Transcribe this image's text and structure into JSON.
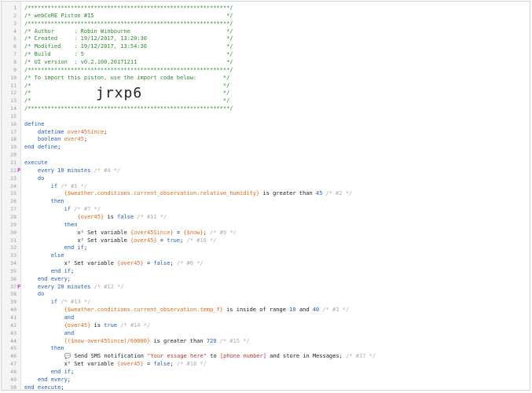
{
  "editor": {
    "lines": [
      {
        "n": "1",
        "segs": [
          {
            "c": "c",
            "t": "/*************************************************************/"
          }
        ]
      },
      {
        "n": "2",
        "segs": [
          {
            "c": "c",
            "t": "/* webCoRE Piston #15                                        */"
          }
        ]
      },
      {
        "n": "3",
        "segs": [
          {
            "c": "c",
            "t": "/*************************************************************/"
          }
        ]
      },
      {
        "n": "4",
        "segs": [
          {
            "c": "c",
            "t": "/* Author      : Robin Winbourne                             */"
          }
        ]
      },
      {
        "n": "5",
        "segs": [
          {
            "c": "c",
            "t": "/* Created     : 19/12/2017, 13:20:30                        */"
          }
        ]
      },
      {
        "n": "6",
        "segs": [
          {
            "c": "c",
            "t": "/* Modified    : 19/12/2017, 13:54:30                        */"
          }
        ]
      },
      {
        "n": "7",
        "segs": [
          {
            "c": "c",
            "t": "/* Build       : 5                                           */"
          }
        ]
      },
      {
        "n": "8",
        "segs": [
          {
            "c": "c",
            "t": "/* UI version  : v0.2.100.20171211                           */"
          }
        ]
      },
      {
        "n": "9",
        "segs": [
          {
            "c": "c",
            "t": "/*************************************************************/"
          }
        ]
      },
      {
        "n": "10",
        "segs": [
          {
            "c": "c",
            "t": "/* To import this piston, use the import code below:        */"
          }
        ]
      },
      {
        "n": "11",
        "segs": [
          {
            "c": "c",
            "t": "/*                                                          */"
          }
        ]
      },
      {
        "n": "12",
        "segs": [
          {
            "c": "c",
            "t": "/*                                                          */"
          }
        ]
      },
      {
        "n": "13",
        "segs": [
          {
            "c": "c",
            "t": "/*                                                          */"
          }
        ]
      },
      {
        "n": "14",
        "segs": [
          {
            "c": "c",
            "t": "/*************************************************************/"
          }
        ]
      },
      {
        "n": "15",
        "segs": []
      },
      {
        "n": "16",
        "segs": [
          {
            "c": "kw",
            "t": "define"
          }
        ]
      },
      {
        "n": "17",
        "segs": [
          {
            "c": "t",
            "t": "    "
          },
          {
            "c": "ty",
            "t": "datetime "
          },
          {
            "c": "v",
            "t": "over45Since"
          },
          {
            "c": "t",
            "t": ";"
          }
        ]
      },
      {
        "n": "18",
        "segs": [
          {
            "c": "t",
            "t": "    "
          },
          {
            "c": "ty",
            "t": "boolean "
          },
          {
            "c": "v",
            "t": "over45"
          },
          {
            "c": "t",
            "t": ";"
          }
        ]
      },
      {
        "n": "19",
        "segs": [
          {
            "c": "kw",
            "t": "end define"
          },
          {
            "c": "t",
            "t": ";"
          }
        ]
      },
      {
        "n": "20",
        "segs": []
      },
      {
        "n": "21",
        "segs": [
          {
            "c": "kw",
            "t": "execute"
          }
        ]
      },
      {
        "n": "22",
        "flag": "P",
        "segs": [
          {
            "c": "t",
            "t": "    "
          },
          {
            "c": "kw",
            "t": "every "
          },
          {
            "c": "n",
            "t": "10"
          },
          {
            "c": "kw",
            "t": " minutes "
          },
          {
            "c": "cg",
            "t": "/* #4 */"
          }
        ]
      },
      {
        "n": "23",
        "segs": [
          {
            "c": "t",
            "t": "    "
          },
          {
            "c": "kw",
            "t": "do"
          }
        ]
      },
      {
        "n": "24",
        "segs": [
          {
            "c": "t",
            "t": "        "
          },
          {
            "c": "kw",
            "t": "if "
          },
          {
            "c": "cg",
            "t": "/* #1 */"
          }
        ]
      },
      {
        "n": "25",
        "segs": [
          {
            "c": "t",
            "t": "            "
          },
          {
            "c": "v",
            "t": "{$weather.conditions.current_observation.relative_humidity}"
          },
          {
            "c": "t",
            "t": " is greater than "
          },
          {
            "c": "n",
            "t": "45"
          },
          {
            "c": "cg",
            "t": " /* #2 */"
          }
        ]
      },
      {
        "n": "26",
        "segs": [
          {
            "c": "t",
            "t": "        "
          },
          {
            "c": "kw",
            "t": "then"
          }
        ]
      },
      {
        "n": "27",
        "segs": [
          {
            "c": "t",
            "t": "            "
          },
          {
            "c": "kw",
            "t": "if "
          },
          {
            "c": "cg",
            "t": "/* #7 */"
          }
        ]
      },
      {
        "n": "28",
        "segs": [
          {
            "c": "t",
            "t": "                "
          },
          {
            "c": "v",
            "t": "{over45}"
          },
          {
            "c": "t",
            "t": " is "
          },
          {
            "c": "kw",
            "t": "false"
          },
          {
            "c": "cg",
            "t": " /* #11 */"
          }
        ]
      },
      {
        "n": "29",
        "segs": [
          {
            "c": "t",
            "t": "            "
          },
          {
            "c": "kw",
            "t": "then"
          }
        ]
      },
      {
        "n": "30",
        "segs": [
          {
            "c": "t",
            "t": "                "
          },
          {
            "c": "t",
            "t": "x² Set variable "
          },
          {
            "c": "v",
            "t": "{over45Since}"
          },
          {
            "c": "t",
            "t": " = "
          },
          {
            "c": "v",
            "t": "{$now}"
          },
          {
            "c": "t",
            "t": ";"
          },
          {
            "c": "cg",
            "t": " /* #9 */"
          }
        ]
      },
      {
        "n": "31",
        "segs": [
          {
            "c": "t",
            "t": "                "
          },
          {
            "c": "t",
            "t": "x² Set variable "
          },
          {
            "c": "v",
            "t": "{over45}"
          },
          {
            "c": "t",
            "t": " = "
          },
          {
            "c": "kw",
            "t": "true"
          },
          {
            "c": "t",
            "t": ";"
          },
          {
            "c": "cg",
            "t": " /* #10 */"
          }
        ]
      },
      {
        "n": "32",
        "segs": [
          {
            "c": "t",
            "t": "            "
          },
          {
            "c": "kw",
            "t": "end if"
          },
          {
            "c": "t",
            "t": ";"
          }
        ]
      },
      {
        "n": "33",
        "segs": [
          {
            "c": "t",
            "t": "        "
          },
          {
            "c": "kw",
            "t": "else"
          }
        ]
      },
      {
        "n": "34",
        "segs": [
          {
            "c": "t",
            "t": "            "
          },
          {
            "c": "t",
            "t": "x² Set variable "
          },
          {
            "c": "v",
            "t": "{over45}"
          },
          {
            "c": "t",
            "t": " = "
          },
          {
            "c": "kw",
            "t": "false"
          },
          {
            "c": "t",
            "t": ";"
          },
          {
            "c": "cg",
            "t": " /* #6 */"
          }
        ]
      },
      {
        "n": "35",
        "segs": [
          {
            "c": "t",
            "t": "        "
          },
          {
            "c": "kw",
            "t": "end if"
          },
          {
            "c": "t",
            "t": ";"
          }
        ]
      },
      {
        "n": "36",
        "segs": [
          {
            "c": "t",
            "t": "    "
          },
          {
            "c": "kw",
            "t": "end every"
          },
          {
            "c": "t",
            "t": ";"
          }
        ]
      },
      {
        "n": "37",
        "flag": "P",
        "segs": [
          {
            "c": "t",
            "t": "    "
          },
          {
            "c": "kw",
            "t": "every "
          },
          {
            "c": "n",
            "t": "20"
          },
          {
            "c": "kw",
            "t": " minutes "
          },
          {
            "c": "cg",
            "t": "/* #12 */"
          }
        ]
      },
      {
        "n": "38",
        "segs": [
          {
            "c": "t",
            "t": "    "
          },
          {
            "c": "kw",
            "t": "do"
          }
        ]
      },
      {
        "n": "39",
        "segs": [
          {
            "c": "t",
            "t": "        "
          },
          {
            "c": "kw",
            "t": "if "
          },
          {
            "c": "cg",
            "t": "/* #13 */"
          }
        ]
      },
      {
        "n": "40",
        "segs": [
          {
            "c": "t",
            "t": "            "
          },
          {
            "c": "v",
            "t": "{$weather.conditions.current_observation.temp_f}"
          },
          {
            "c": "t",
            "t": " is inside of range "
          },
          {
            "c": "n",
            "t": "10"
          },
          {
            "c": "t",
            "t": " and "
          },
          {
            "c": "n",
            "t": "40"
          },
          {
            "c": "cg",
            "t": " /* #3 */"
          }
        ]
      },
      {
        "n": "41",
        "segs": [
          {
            "c": "t",
            "t": "            "
          },
          {
            "c": "kw",
            "t": "and"
          }
        ]
      },
      {
        "n": "42",
        "segs": [
          {
            "c": "t",
            "t": "            "
          },
          {
            "c": "v",
            "t": "{over45}"
          },
          {
            "c": "t",
            "t": " is "
          },
          {
            "c": "kw",
            "t": "true"
          },
          {
            "c": "cg",
            "t": " /* #14 */"
          }
        ]
      },
      {
        "n": "43",
        "segs": [
          {
            "c": "t",
            "t": "            "
          },
          {
            "c": "kw",
            "t": "and"
          }
        ]
      },
      {
        "n": "44",
        "segs": [
          {
            "c": "t",
            "t": "            "
          },
          {
            "c": "v",
            "t": "{($now-over45Since)/60000}"
          },
          {
            "c": "t",
            "t": " is greater than "
          },
          {
            "c": "n",
            "t": "720"
          },
          {
            "c": "cg",
            "t": " /* #15 */"
          }
        ]
      },
      {
        "n": "45",
        "segs": [
          {
            "c": "t",
            "t": "        "
          },
          {
            "c": "kw",
            "t": "then"
          }
        ]
      },
      {
        "n": "46",
        "segs": [
          {
            "c": "t",
            "t": "            "
          },
          {
            "c": "t",
            "t": "💬 Send SMS notification "
          },
          {
            "c": "s",
            "t": "\"Your essage here\""
          },
          {
            "c": "t",
            "t": " to "
          },
          {
            "c": "s",
            "t": "[phone number]"
          },
          {
            "c": "t",
            "t": " and store in Messages;"
          },
          {
            "c": "cg",
            "t": " /* #17 */"
          }
        ]
      },
      {
        "n": "47",
        "segs": [
          {
            "c": "t",
            "t": "            "
          },
          {
            "c": "t",
            "t": "x² Set variable "
          },
          {
            "c": "v",
            "t": "{over45}"
          },
          {
            "c": "t",
            "t": " = "
          },
          {
            "c": "kw",
            "t": "false"
          },
          {
            "c": "t",
            "t": ";"
          },
          {
            "c": "cg",
            "t": " /* #18 */"
          }
        ]
      },
      {
        "n": "48",
        "segs": [
          {
            "c": "t",
            "t": "        "
          },
          {
            "c": "kw",
            "t": "end if"
          },
          {
            "c": "t",
            "t": ";"
          }
        ]
      },
      {
        "n": "49",
        "segs": [
          {
            "c": "t",
            "t": "    "
          },
          {
            "c": "kw",
            "t": "end every"
          },
          {
            "c": "t",
            "t": ";"
          }
        ]
      },
      {
        "n": "50",
        "segs": [
          {
            "c": "kw",
            "t": "end execute"
          },
          {
            "c": "t",
            "t": ";"
          }
        ]
      }
    ],
    "import_code": "jrxp6"
  },
  "colors": {
    "comment": "#2e8b2e",
    "keyword": "#1f5fbf",
    "variable": "#e06a1e",
    "string": "#c0392b",
    "flag": "#c040c0"
  }
}
